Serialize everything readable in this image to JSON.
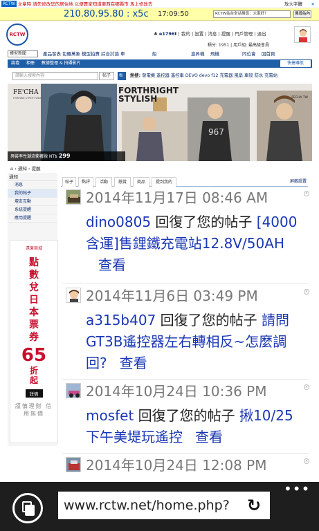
{
  "notice": {
    "brand": "RCTW",
    "text": "文章時 請先修改您的居住地 以便賣家知道東西在哪縣市 馬上修改去",
    "zoom": "放大字體",
    "close": "✕"
  },
  "ipbar": {
    "ip": "210.80.95.80 : x5c",
    "time": "17:09:50",
    "search_placeholder": "RCTW站台全站搜尋：大家好！",
    "search_btn": "搜尋站內"
  },
  "logo": {
    "text": "RCTW"
  },
  "user": {
    "name": "e1796t",
    "links": [
      "我的",
      "設置",
      "消息",
      "提醒",
      "門戶管理",
      "退出"
    ],
    "points_label": "積分: 1951",
    "group_label": "用戶組: 最高級會員"
  },
  "categories": {
    "select_value": "模型新聞",
    "items": [
      "產品發表",
      "包羅萬象",
      "模型拍賣",
      "綜合討論",
      "車",
      "船",
      "直昇機",
      "飛機",
      "同位會",
      "回首頁"
    ]
  },
  "navbar": {
    "items": [
      "論壇",
      "相冊",
      "數據整理 & 拍攝影片"
    ],
    "quick": "快捷導航"
  },
  "search": {
    "placeholder": "請輸入搜索內容",
    "type": "帖子",
    "go": "🔍",
    "hot_label": "熱搜:",
    "hot_words": "發電機 遙控器 遙控車 DEVO devo f12 充電器 風扇 車殼 防水 充電站"
  },
  "banner": {
    "brand": "FE'CHA",
    "brand_sub": "FEMININE STREET WEAR",
    "slogan_1": "FORTHRIGHT",
    "slogan_2": "STYLISH",
    "promo": "男裝率性潮流衝著脫 NT$",
    "price": "299",
    "side": "FECHA TW"
  },
  "breadcrumb": "⌂ › 通知 › 提醒",
  "sidebar": {
    "head": "通知",
    "items": [
      "消息",
      "我的帖子",
      "壇友互動",
      "系統提醒",
      "應用提醒"
    ]
  },
  "ad": {
    "shop": "遠東商城",
    "headline": "點數兌日本票券",
    "number": "65",
    "off": "折起",
    "cta": "詳情",
    "note": "謹慎理財 信用無價"
  },
  "tabs": {
    "items": [
      "帖子",
      "點評",
      "活動",
      "懸賞",
      "商品",
      "提到我的"
    ],
    "settings": "屏蔽設置"
  },
  "notifications": [
    {
      "date": "2014年11月17日 08:46 AM",
      "user": "dino0805",
      "action": " 回復了您的帖子 ",
      "title": "[4000含運]售鋰鐵充電站12.8V/50AH",
      "view": "查看"
    },
    {
      "date": "2014年11月6日 03:49 PM",
      "user": "a315b407",
      "action": " 回復了您的帖子 ",
      "title": "請問GT3B遙控器左右轉相反~怎麼調回?",
      "view": "查看"
    },
    {
      "date": "2014年10月24日 10:36 PM",
      "user": "mosfet",
      "action": " 回復了您的帖子 ",
      "title": "揪10/25下午美堤玩遙控",
      "view": "查看"
    },
    {
      "date": "2014年10月24日 12:08 PM"
    }
  ],
  "browser": {
    "url": "www.rctw.net/home.php?",
    "refresh": "↻",
    "more": "•••"
  }
}
